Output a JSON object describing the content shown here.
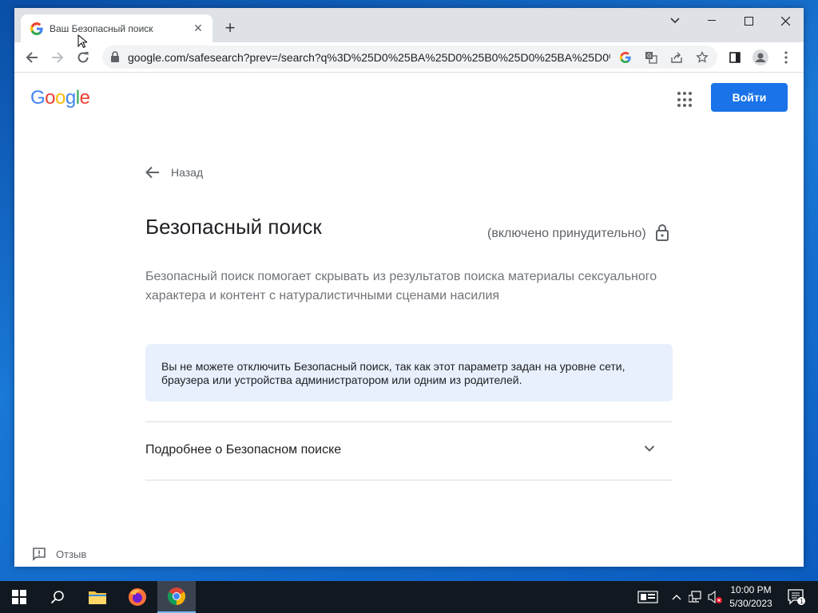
{
  "browser": {
    "tab_title": "Ваш Безопасный поиск",
    "new_tab": "+",
    "url": "google.com/safesearch?prev=/search?q%3D%25D0%25BA%25D0%25B0%25D0%25BA%25D0%...",
    "minimize": "—",
    "maximize": "☐",
    "close": "✕",
    "dropdown": "⌄"
  },
  "header": {
    "logo": [
      "G",
      "o",
      "o",
      "g",
      "l",
      "e"
    ],
    "logo_colors": [
      "#4285F4",
      "#EA4335",
      "#FBBC05",
      "#4285F4",
      "#34A853",
      "#EA4335"
    ],
    "signin_label": "Войти"
  },
  "main": {
    "back_label": "Назад",
    "title": "Безопасный поиск",
    "forced_label": "(включено принудительно)",
    "description": "Безопасный поиск помогает скрывать из результатов поиска материалы сексуального характера и контент с натуралистичными сценами насилия",
    "notice": "Вы не можете отключить Безопасный поиск, так как этот параметр задан на уровне сети, браузера или устройства администратором или одним из родителей.",
    "more_label": "Подробнее о Безопасном поиске"
  },
  "footer": {
    "feedback_label": "Отзыв"
  },
  "taskbar": {
    "time": "10:00 PM",
    "date": "5/30/2023",
    "notification_count": "1"
  },
  "colors": {
    "accent": "#1a73e8",
    "notice_bg": "#e8f0fe"
  }
}
